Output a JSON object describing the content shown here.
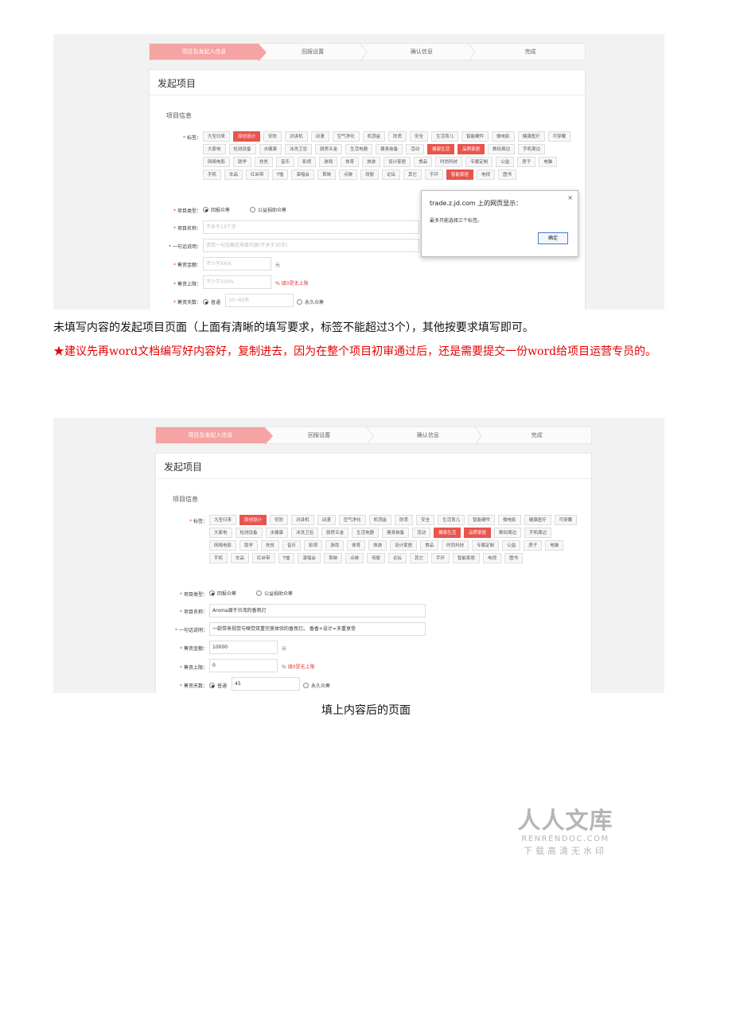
{
  "shot1": {
    "steps": [
      "项目及发起人信息",
      "回报设置",
      "确认信息",
      "完成"
    ],
    "panel_title": "发起项目",
    "section": "项目信息",
    "labels": {
      "tags": "标签：",
      "type": "项目类型：",
      "name": "项目名称：",
      "desc": "一句话说明：",
      "amount": "筹资金额：",
      "limit": "筹资上限：",
      "days": "筹资天数："
    },
    "tags": [
      {
        "t": "大圣归来",
        "s": false
      },
      {
        "t": "原创设计",
        "s": true
      },
      {
        "t": "安防",
        "s": false
      },
      {
        "t": "对讲机",
        "s": false
      },
      {
        "t": "动漫",
        "s": false
      },
      {
        "t": "空气净化",
        "s": false
      },
      {
        "t": "机顶盒",
        "s": false
      },
      {
        "t": "防丢",
        "s": false
      },
      {
        "t": "安全",
        "s": false
      },
      {
        "t": "生活育儿",
        "s": false
      },
      {
        "t": "智能硬件",
        "s": false
      },
      {
        "t": "微电影",
        "s": false
      },
      {
        "t": "健康医疗",
        "s": false
      },
      {
        "t": "可穿戴",
        "s": false
      },
      {
        "t": "大家电",
        "s": false
      },
      {
        "t": "检测设备",
        "s": false
      },
      {
        "t": "水健康",
        "s": false
      },
      {
        "t": "冰洗卫浴",
        "s": false
      },
      {
        "t": "厨房五金",
        "s": false
      },
      {
        "t": "生活电器",
        "s": false
      },
      {
        "t": "健身装备",
        "s": false
      },
      {
        "t": "活动",
        "s": false
      },
      {
        "t": "健康生活",
        "s": true
      },
      {
        "t": "品质家居",
        "s": true
      },
      {
        "t": "数码周边",
        "s": false
      },
      {
        "t": "手机周边",
        "s": false
      },
      {
        "t": "网络电影",
        "s": false
      },
      {
        "t": "助学",
        "s": false
      },
      {
        "t": "扶贫",
        "s": false
      },
      {
        "t": "音乐",
        "s": false
      },
      {
        "t": "影视",
        "s": false
      },
      {
        "t": "游戏",
        "s": false
      },
      {
        "t": "体育",
        "s": false
      },
      {
        "t": "旅游",
        "s": false
      },
      {
        "t": "设计家居",
        "s": false
      },
      {
        "t": "食品",
        "s": false
      },
      {
        "t": "时尚科技",
        "s": false
      },
      {
        "t": "专属定制",
        "s": false
      },
      {
        "t": "公益",
        "s": false
      },
      {
        "t": "房子",
        "s": false
      },
      {
        "t": "电脑",
        "s": false
      },
      {
        "t": "手机",
        "s": false
      },
      {
        "t": "车品",
        "s": false
      },
      {
        "t": "红丝带",
        "s": false
      },
      {
        "t": "T恤",
        "s": false
      },
      {
        "t": "演唱会",
        "s": false
      },
      {
        "t": "首映",
        "s": false
      },
      {
        "t": "点映",
        "s": false
      },
      {
        "t": "母婴",
        "s": false
      },
      {
        "t": "论坛",
        "s": false
      },
      {
        "t": "其它",
        "s": false
      },
      {
        "t": "手环",
        "s": false
      },
      {
        "t": "智能家居",
        "s": true
      },
      {
        "t": "电视",
        "s": false
      },
      {
        "t": "图书",
        "s": false
      }
    ],
    "type_opt1": "回报众筹",
    "type_opt2": "公益捐助众筹",
    "name_placeholder": "不多于13个字",
    "desc_placeholder": "请用一句话概括项目内容(不多于30字)",
    "amount_placeholder": "不少于XX元",
    "amount_unit": "元",
    "limit_placeholder": "不少于100%",
    "limit_unit": "%",
    "limit_note": "填0是无上限",
    "days_opt1": "普通",
    "days_placeholder": "10~60天",
    "days_opt2": "永久众筹",
    "dialog": {
      "title": "trade.z.jd.com 上的网页显示：",
      "message": "最多只能选择三个标签。",
      "ok": "确定",
      "close": "×"
    }
  },
  "para1": "未填写内容的发起项目页面（上面有清晰的填写要求，标签不能超过3个），其他按要求填写即可。",
  "para2": "★建议先再word文档编写好内容好，复制进去，因为在整个项目初审通过后，还是需要提交一份word给项目运营专员的。",
  "shot2": {
    "steps": [
      "项目及发起人信息",
      "回报设置",
      "确认信息",
      "完成"
    ],
    "panel_title": "发起项目",
    "section": "项目信息",
    "labels": {
      "tags": "标签：",
      "type": "项目类型：",
      "name": "项目名称：",
      "desc": "一句话说明：",
      "amount": "筹资金额：",
      "limit": "筹资上限：",
      "days": "筹资天数："
    },
    "tags": [
      {
        "t": "大圣归来",
        "s": false
      },
      {
        "t": "原创设计",
        "s": true
      },
      {
        "t": "安防",
        "s": false
      },
      {
        "t": "对讲机",
        "s": false
      },
      {
        "t": "动漫",
        "s": false
      },
      {
        "t": "空气净化",
        "s": false
      },
      {
        "t": "机顶盒",
        "s": false
      },
      {
        "t": "防丢",
        "s": false
      },
      {
        "t": "安全",
        "s": false
      },
      {
        "t": "生活育儿",
        "s": false
      },
      {
        "t": "智能硬件",
        "s": false
      },
      {
        "t": "微电影",
        "s": false
      },
      {
        "t": "健康医疗",
        "s": false
      },
      {
        "t": "可穿戴",
        "s": false
      },
      {
        "t": "大家电",
        "s": false
      },
      {
        "t": "检测设备",
        "s": false
      },
      {
        "t": "水健康",
        "s": false
      },
      {
        "t": "冰洗卫浴",
        "s": false
      },
      {
        "t": "厨房五金",
        "s": false
      },
      {
        "t": "生活电器",
        "s": false
      },
      {
        "t": "健身装备",
        "s": false
      },
      {
        "t": "活动",
        "s": false
      },
      {
        "t": "健康生活",
        "s": true
      },
      {
        "t": "品质家居",
        "s": true
      },
      {
        "t": "数码周边",
        "s": false
      },
      {
        "t": "手机周边",
        "s": false
      },
      {
        "t": "网络电影",
        "s": false
      },
      {
        "t": "助学",
        "s": false
      },
      {
        "t": "扶贫",
        "s": false
      },
      {
        "t": "音乐",
        "s": false
      },
      {
        "t": "影视",
        "s": false
      },
      {
        "t": "游戏",
        "s": false
      },
      {
        "t": "体育",
        "s": false
      },
      {
        "t": "旅游",
        "s": false
      },
      {
        "t": "设计家居",
        "s": false
      },
      {
        "t": "食品",
        "s": false
      },
      {
        "t": "时尚科技",
        "s": false
      },
      {
        "t": "专属定制",
        "s": false
      },
      {
        "t": "公益",
        "s": false
      },
      {
        "t": "房子",
        "s": false
      },
      {
        "t": "电脑",
        "s": false
      },
      {
        "t": "手机",
        "s": false
      },
      {
        "t": "车品",
        "s": false
      },
      {
        "t": "红丝带",
        "s": false
      },
      {
        "t": "T恤",
        "s": false
      },
      {
        "t": "演唱会",
        "s": false
      },
      {
        "t": "首映",
        "s": false
      },
      {
        "t": "点映",
        "s": false
      },
      {
        "t": "母婴",
        "s": false
      },
      {
        "t": "论坛",
        "s": false
      },
      {
        "t": "其它",
        "s": false
      },
      {
        "t": "手环",
        "s": false
      },
      {
        "t": "智能家居",
        "s": false
      },
      {
        "t": "电视",
        "s": false
      },
      {
        "t": "图书",
        "s": false
      }
    ],
    "type_opt1": "回报众筹",
    "type_opt2": "公益捐助众筹",
    "name_value": "Aroma源于台湾的香氛灯",
    "desc_value": "一款带来视觉与嗅觉双重完美体验的香氛灯。 香香+设计=多重享受",
    "amount_value": "10000",
    "amount_unit": "元",
    "limit_value": "0",
    "limit_unit": "%",
    "limit_note": "填0是无上限",
    "days_opt1": "普通",
    "days_value": "45",
    "days_opt2": "永久众筹"
  },
  "caption": "填上内容后的页面",
  "watermark": {
    "cn": "人人文库",
    "en": "RENRENDOC.COM",
    "sub": "下载高清无水印"
  }
}
